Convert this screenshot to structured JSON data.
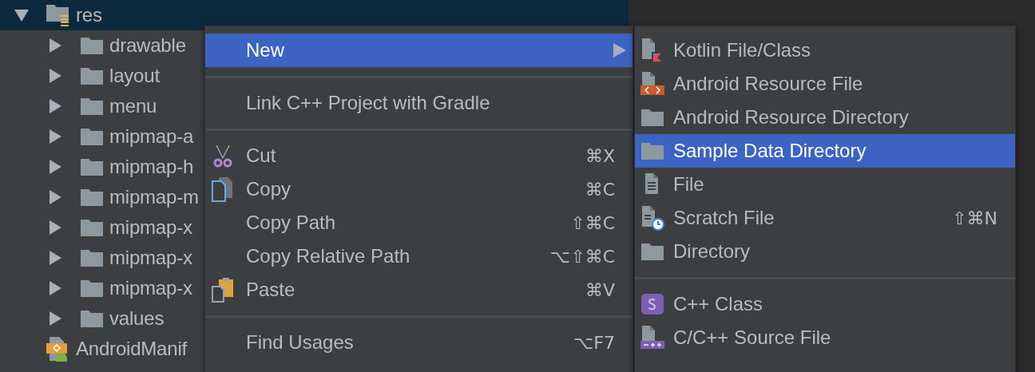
{
  "project_tree": {
    "nodes": [
      {
        "kind": "resource-folder",
        "label": "res",
        "expanded": true,
        "selected": true,
        "children": [
          {
            "kind": "folder",
            "label": "drawable",
            "expanded": false,
            "selected": false
          },
          {
            "kind": "folder",
            "label": "layout",
            "expanded": false,
            "selected": false
          },
          {
            "kind": "folder",
            "label": "menu",
            "expanded": false,
            "selected": false
          },
          {
            "kind": "folder",
            "label": "mipmap-a",
            "expanded": false,
            "selected": false
          },
          {
            "kind": "folder",
            "label": "mipmap-h",
            "expanded": false,
            "selected": false
          },
          {
            "kind": "folder",
            "label": "mipmap-m",
            "expanded": false,
            "selected": false
          },
          {
            "kind": "folder",
            "label": "mipmap-x",
            "expanded": false,
            "selected": false
          },
          {
            "kind": "folder",
            "label": "mipmap-x",
            "expanded": false,
            "selected": false
          },
          {
            "kind": "folder",
            "label": "mipmap-x",
            "expanded": false,
            "selected": false
          },
          {
            "kind": "folder",
            "label": "values",
            "expanded": false,
            "selected": false
          }
        ]
      },
      {
        "kind": "manifest-file",
        "label": "AndroidManif",
        "selected": false
      }
    ]
  },
  "context_menu": {
    "items": [
      {
        "kind": "submenu",
        "label": "New",
        "selected": true
      },
      {
        "kind": "separator"
      },
      {
        "kind": "plain",
        "label": "Link C++ Project with Gradle",
        "selected": false
      },
      {
        "kind": "separator"
      },
      {
        "kind": "cut",
        "label": "Cut",
        "shortcut": "⌘X",
        "selected": false
      },
      {
        "kind": "copy",
        "label": "Copy",
        "shortcut": "⌘C",
        "selected": false
      },
      {
        "kind": "plain",
        "label": "Copy Path",
        "shortcut": "⇧⌘C",
        "selected": false
      },
      {
        "kind": "plain",
        "label": "Copy Relative Path",
        "shortcut": "⌥⇧⌘C",
        "selected": false
      },
      {
        "kind": "paste",
        "label": "Paste",
        "shortcut": "⌘V",
        "selected": false
      },
      {
        "kind": "separator"
      },
      {
        "kind": "plain",
        "label": "Find Usages",
        "shortcut": "⌥F7",
        "selected": false
      }
    ]
  },
  "new_submenu": {
    "items": [
      {
        "kind": "kotlin-file",
        "label": "Kotlin File/Class",
        "selected": false
      },
      {
        "kind": "resource-file",
        "label": "Android Resource File",
        "selected": false
      },
      {
        "kind": "folder",
        "label": "Android Resource Directory",
        "selected": false
      },
      {
        "kind": "folder",
        "label": "Sample Data Directory",
        "selected": true
      },
      {
        "kind": "file",
        "label": "File",
        "selected": false
      },
      {
        "kind": "scratch-file",
        "label": "Scratch File",
        "shortcut": "⇧⌘N",
        "selected": false
      },
      {
        "kind": "folder",
        "label": "Directory",
        "selected": false
      },
      {
        "kind": "separator"
      },
      {
        "kind": "cpp-class",
        "label": "C++ Class",
        "selected": false
      },
      {
        "kind": "source-file",
        "label": "C/C++ Source File",
        "selected": false
      }
    ]
  }
}
